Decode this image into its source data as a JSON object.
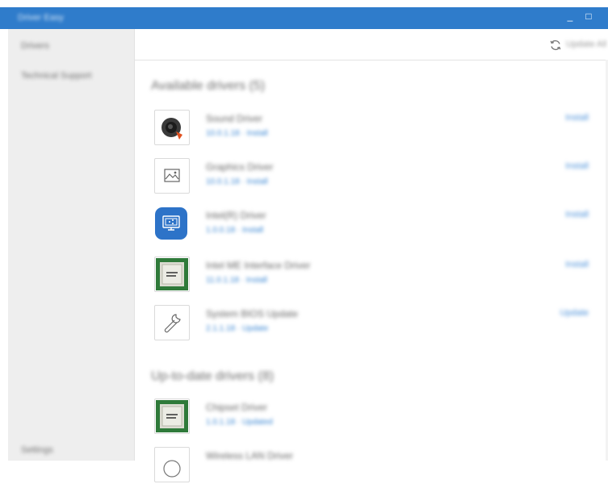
{
  "window": {
    "title": "Driver Easy",
    "minimize": "_",
    "maximize": "□"
  },
  "sidebar": {
    "items": [
      {
        "label": "Drivers"
      },
      {
        "label": "Technical Support"
      }
    ],
    "bottom": {
      "label": "Settings"
    }
  },
  "toolbar": {
    "check_updates": "Update All"
  },
  "available": {
    "title": "Available drivers (5)",
    "drivers": [
      {
        "name": "Sound Driver",
        "meta": "10.0.1.18 · Install",
        "action": "Install",
        "icon": "speaker-icon"
      },
      {
        "name": "Graphics Driver",
        "meta": "10.0.1.18 · Install",
        "action": "Install",
        "icon": "image-icon"
      },
      {
        "name": "Intel(R) Driver",
        "meta": "1.0.0.18 · Install",
        "action": "Install",
        "icon": "screen-share-icon"
      },
      {
        "name": "Intel ME Interface Driver",
        "meta": "11.0.1.18 · Install",
        "action": "Install",
        "icon": "chip-icon"
      },
      {
        "name": "System BIOS Update",
        "meta": "2.1.1.18 · Update",
        "action": "Update",
        "icon": "wrench-icon"
      }
    ]
  },
  "uptodate": {
    "title": "Up-to-date drivers (8)",
    "drivers": [
      {
        "name": "Chipset Driver",
        "meta": "1.0.1.18 · Updated",
        "icon": "chip-icon"
      },
      {
        "name": "Wireless LAN Driver",
        "meta": "",
        "icon": "wifi-icon"
      }
    ]
  },
  "colors": {
    "titlebar": "#2f7ccb",
    "sidebar": "#eeeeee",
    "accent": "#4a90d9"
  }
}
